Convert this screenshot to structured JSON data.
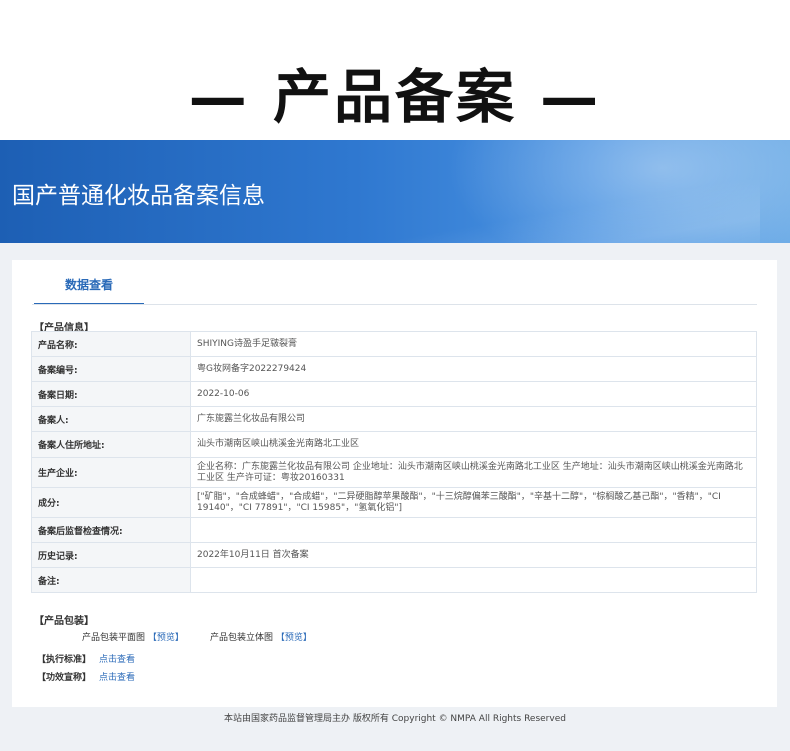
{
  "hero": {
    "title": "— 产品备案 —"
  },
  "banner": {
    "title": "国产普通化妆品备案信息"
  },
  "tabs": [
    {
      "label": "数据查看"
    }
  ],
  "product_info": {
    "section_label": "【产品信息】",
    "rows": [
      {
        "key": "产品名称:",
        "value": "SHIYING诗盈手足皲裂膏"
      },
      {
        "key": "备案编号:",
        "value": "粤G妆网备字2022279424"
      },
      {
        "key": "备案日期:",
        "value": "2022-10-06"
      },
      {
        "key": "备案人:",
        "value": "广东旎露兰化妆品有限公司"
      },
      {
        "key": "备案人住所地址:",
        "value": "汕头市潮南区峡山桃溪金光南路北工业区"
      },
      {
        "key": "生产企业:",
        "value": "企业名称：广东旎露兰化妆品有限公司 企业地址：汕头市潮南区峡山桃溪金光南路北工业区 生产地址：汕头市潮南区峡山桃溪金光南路北工业区 生产许可证：粤妆20160331"
      },
      {
        "key": "成分:",
        "value": "[\"矿脂\"，\"合成蜂蜡\"，\"合成蜡\"，\"二异硬脂醇苹果酸酯\"，\"十三烷醇偏苯三酸酯\"，\"辛基十二醇\"，\"棕榈酸乙基己酯\"，\"香精\"，\"CI 19140\"，\"CI 77891\"，\"CI 15985\"，\"氢氧化铝\"]"
      },
      {
        "key": "备案后监督检查情况:",
        "value": ""
      },
      {
        "key": "历史记录:",
        "value": "2022年10月11日 首次备案"
      },
      {
        "key": "备注:",
        "value": ""
      }
    ]
  },
  "packaging": {
    "section_label": "【产品包装】",
    "flat_label": "产品包装平面图",
    "flat_link": "【预览】",
    "solid_label": "产品包装立体图",
    "solid_link": "【预览】"
  },
  "standard": {
    "label": "【执行标准】",
    "link": "点击查看"
  },
  "efficacy": {
    "label": "【功效宣称】",
    "link": "点击查看"
  },
  "footer": {
    "text": "本站由国家药品监督管理局主办 版权所有 Copyright © NMPA All Rights Reserved"
  }
}
